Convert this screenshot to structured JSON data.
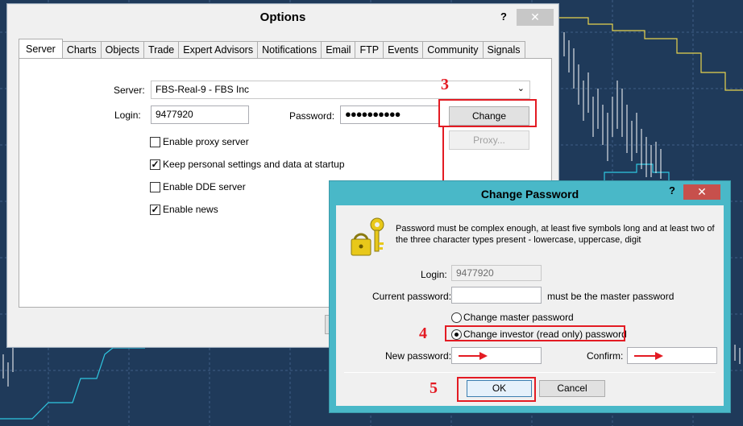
{
  "options": {
    "title": "Options",
    "help": "?",
    "close": "✕",
    "tabs": [
      "Server",
      "Charts",
      "Objects",
      "Trade",
      "Expert Advisors",
      "Notifications",
      "Email",
      "FTP",
      "Events",
      "Community",
      "Signals"
    ],
    "server_label": "Server:",
    "server_value": "FBS-Real-9 - FBS Inc",
    "login_label": "Login:",
    "login_value": "9477920",
    "password_label": "Password:",
    "password_value": "●●●●●●●●●●",
    "change_button": "Change",
    "proxy_button": "Proxy...",
    "checkboxes": [
      {
        "label": "Enable proxy server",
        "checked": false
      },
      {
        "label": "Keep personal settings and data at startup",
        "checked": true
      },
      {
        "label": "Enable DDE server",
        "checked": false
      },
      {
        "label": "Enable news",
        "checked": true
      }
    ]
  },
  "change_password": {
    "title": "Change Password",
    "help": "?",
    "close": "✕",
    "info": "Password must be complex enough, at least five symbols long and at least two of the three character types present - lowercase, uppercase, digit",
    "login_label": "Login:",
    "login_value": "9477920",
    "current_label": "Current password:",
    "current_value": "",
    "current_hint": "must be the master password",
    "radio_master": "Change master password",
    "radio_investor": "Change investor (read only) password",
    "new_label": "New password:",
    "new_value": "",
    "confirm_label": "Confirm:",
    "confirm_value": "",
    "ok_button": "OK",
    "cancel_button": "Cancel",
    "icon": "keys-lock-icon"
  },
  "annotations": {
    "step3": "3",
    "step4": "4",
    "step5": "5",
    "color": "#e31b23"
  }
}
